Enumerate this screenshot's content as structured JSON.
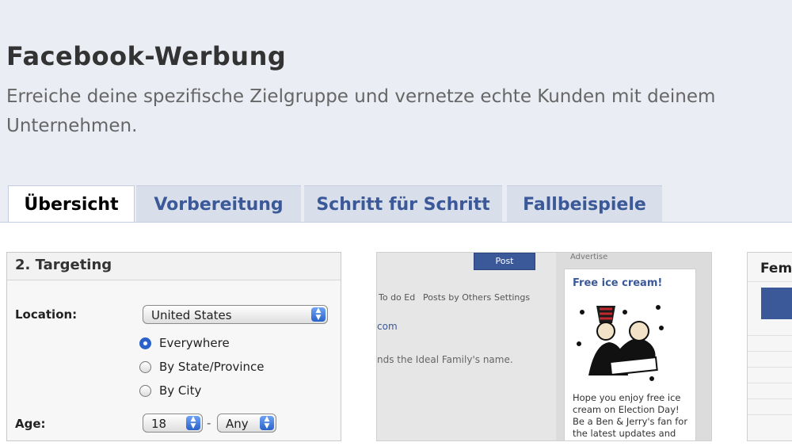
{
  "header": {
    "title": "Facebook-Werbung",
    "subtitle": "Erreiche deine spezifische Zielgruppe und vernetze echte Kunden mit deinem Unternehmen."
  },
  "tabs": [
    {
      "label": "Übersicht",
      "active": true
    },
    {
      "label": "Vorbereitung",
      "active": false
    },
    {
      "label": "Schritt für Schritt",
      "active": false
    },
    {
      "label": "Fallbeispiele",
      "active": false
    }
  ],
  "targeting": {
    "title": "2. Targeting",
    "location_label": "Location:",
    "location_value": "United States",
    "radios": [
      {
        "label": "Everywhere",
        "checked": true
      },
      {
        "label": "By State/Province",
        "checked": false
      },
      {
        "label": "By City",
        "checked": false
      }
    ],
    "age_label": "Age:",
    "age_from": "18",
    "age_to": "Any",
    "age_separator": "-"
  },
  "ad_preview": {
    "button_label": "Post",
    "top_label": "Advertise",
    "links": [
      "To do Ed",
      "Posts by Others",
      "Settings"
    ],
    "url_text": "com",
    "note_text": "nds the Ideal Family's name.",
    "ad_title": "Free ice cream!",
    "ad_body": "Hope you enjoy free ice cream on Election Day! Be a Ben & Jerry's fan for the latest updates and the first to know about"
  },
  "panel3": {
    "title": "Fem"
  },
  "colors": {
    "brand": "#3b5998",
    "tab_bg": "#d8dfea",
    "page_bg": "#ebedf4"
  }
}
